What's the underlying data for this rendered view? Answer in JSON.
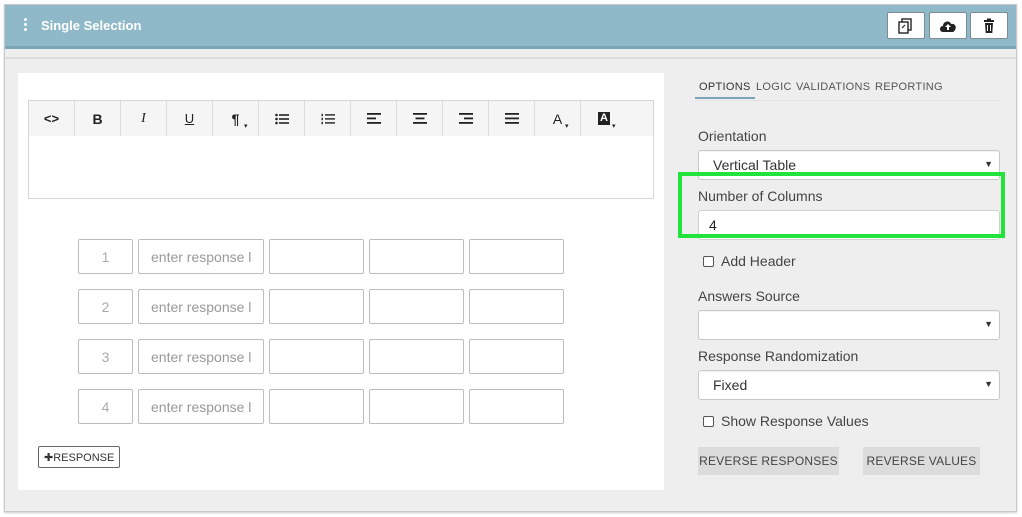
{
  "header": {
    "title": "Single Selection",
    "buttons": [
      {
        "name": "copy-button",
        "icon": "copy-icon"
      },
      {
        "name": "upload-button",
        "icon": "cloud-upload-icon"
      },
      {
        "name": "delete-button",
        "icon": "trash-icon"
      }
    ]
  },
  "editor": {
    "toolbar": [
      {
        "name": "source-code",
        "label": "<>"
      },
      {
        "name": "bold",
        "label": "B"
      },
      {
        "name": "italic",
        "label": "I"
      },
      {
        "name": "underline",
        "label": "U"
      },
      {
        "name": "paragraph",
        "label": "¶"
      },
      {
        "name": "bullet-list",
        "label": "bullet-list-icon"
      },
      {
        "name": "numbered-list",
        "label": "numbered-list-icon"
      },
      {
        "name": "align-left",
        "label": "align-left-icon"
      },
      {
        "name": "align-center",
        "label": "align-center-icon"
      },
      {
        "name": "align-right",
        "label": "align-right-icon"
      },
      {
        "name": "justify",
        "label": "justify-icon"
      },
      {
        "name": "font-color",
        "label": "A"
      },
      {
        "name": "background-color",
        "label": "A"
      }
    ]
  },
  "responses": [
    {
      "number": "1",
      "placeholder": "enter response l"
    },
    {
      "number": "2",
      "placeholder": "enter response l"
    },
    {
      "number": "3",
      "placeholder": "enter response l"
    },
    {
      "number": "4",
      "placeholder": "enter response l"
    }
  ],
  "add_response_label": "✚RESPONSE",
  "tabs": [
    "OPTIONS",
    "LOGIC",
    "VALIDATIONS",
    "REPORTING"
  ],
  "options": {
    "orientation_label": "Orientation",
    "orientation_value": "Vertical Table",
    "columns_label": "Number of Columns",
    "columns_value": "4",
    "add_header_label": "Add Header",
    "answers_source_label": "Answers Source",
    "answers_source_value": "",
    "randomization_label": "Response Randomization",
    "randomization_value": "Fixed",
    "show_values_label": "Show Response Values",
    "reverse_responses_label": "REVERSE RESPONSES",
    "reverse_values_label": "REVERSE VALUES"
  },
  "colors": {
    "header_bg": "#8fb8c9",
    "highlight": "#22e33a"
  }
}
